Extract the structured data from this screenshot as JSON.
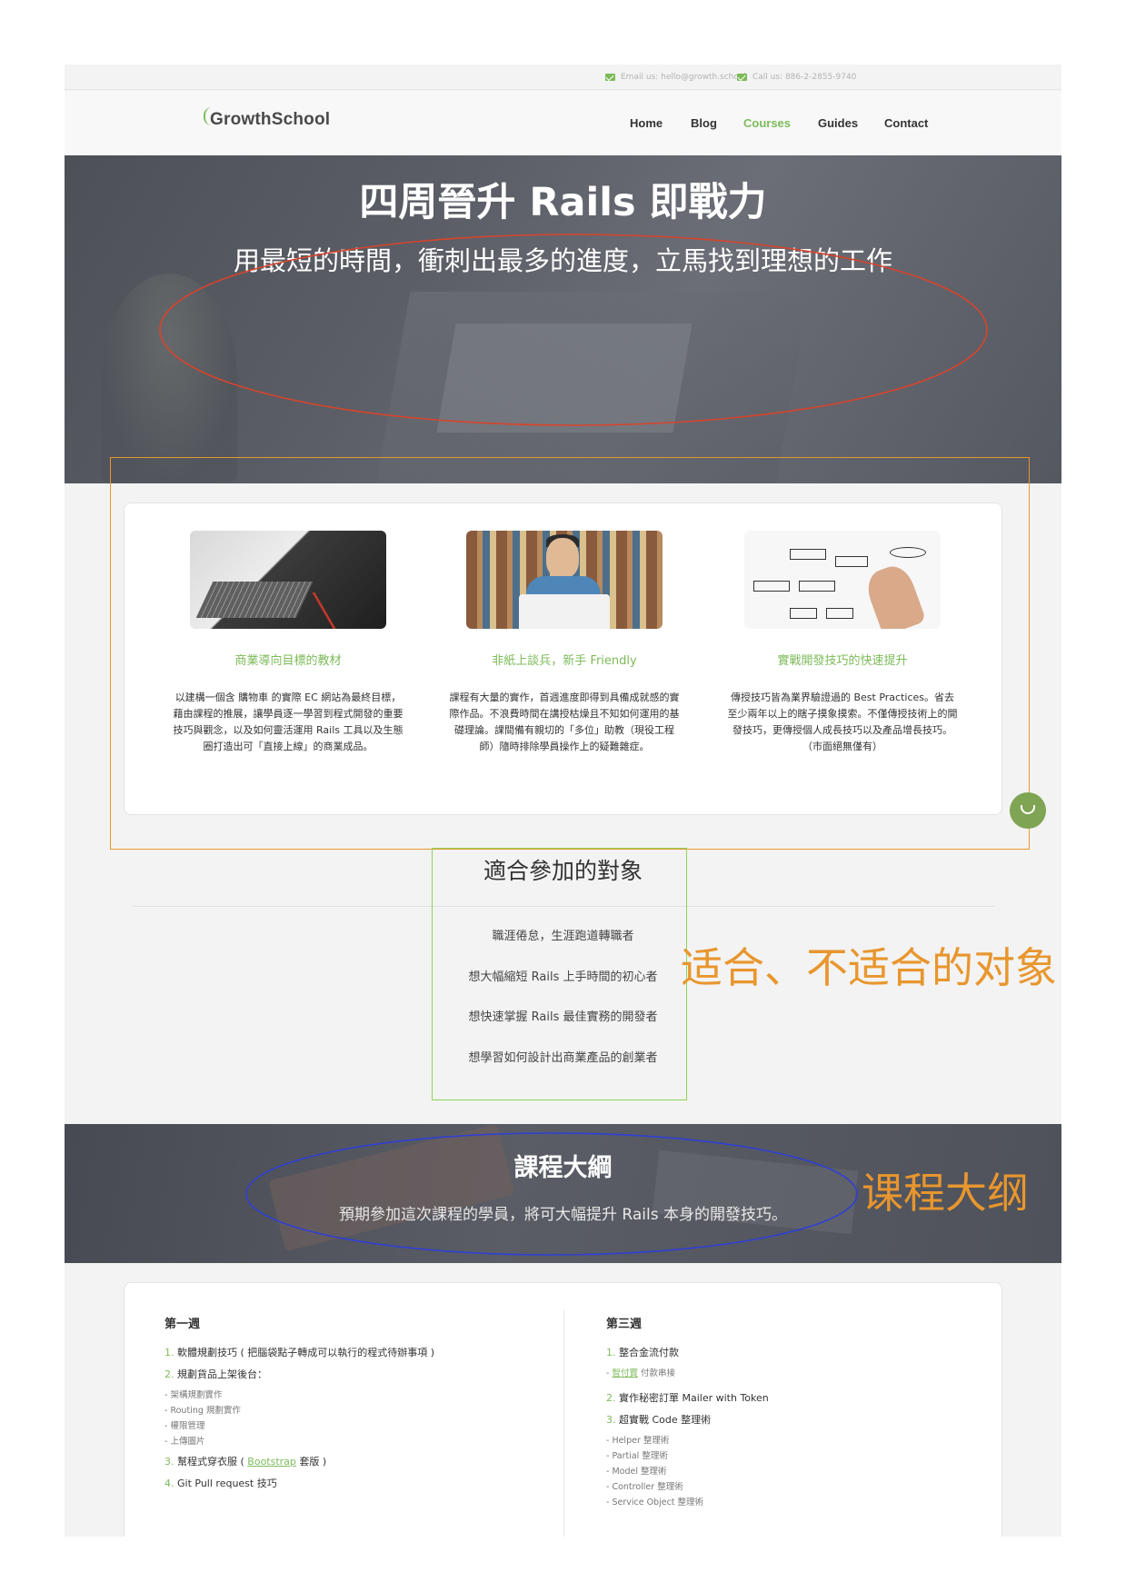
{
  "topbar": {
    "email": "Email us: hello@growth.school",
    "phone": "Call us: 886-2-2855-9740"
  },
  "header": {
    "logo": "GrowthSchool",
    "nav": [
      "Home",
      "Blog",
      "Courses",
      "Guides",
      "Contact"
    ],
    "active_nav": "Courses"
  },
  "hero": {
    "title": "四周晉升 Rails 即戰力",
    "subtitle": "用最短的時間，衝刺出最多的進度，立馬找到理想的工作"
  },
  "features": [
    {
      "title": "商業導向目標的教材",
      "body": "以建構一個含 購物車 的實際 EC 網站為最終目標，藉由課程的推展，讓學員逐一學習到程式開發的重要技巧與觀念，以及如何靈活運用 Rails 工具以及生態圈打造出可「直接上線」的商業成品。"
    },
    {
      "title": "非紙上談兵，新手 Friendly",
      "body": "課程有大量的實作，首週進度即得到具備成就感的實際作品。不浪費時間在講授枯燥且不知如何運用的基礎理論。課間備有親切的「多位」助教（現役工程師）隨時排除學員操作上的疑難雜症。"
    },
    {
      "title": "實戰開發技巧的快速提升",
      "body": "傳授技巧皆為業界驗證過的 Best Practices。省去至少兩年以上的瞎子摸象摸索。不僅傳授技術上的開發技巧，更傳授個人成長技巧以及產品增長技巧。（市面絕無僅有）"
    }
  ],
  "audience": {
    "title": "適合參加的對象",
    "items": [
      "職涯倦怠，生涯跑道轉職者",
      "想大幅縮短 Rails 上手時間的初心者",
      "想快速掌握 Rails 最佳實務的開發者",
      "想學習如何設計出商業產品的創業者"
    ]
  },
  "outline": {
    "title": "課程大綱",
    "subtitle": "預期參加這次課程的學員，將可大幅提升 Rails 本身的開發技巧。"
  },
  "syllabus": {
    "week1": {
      "title": "第一週",
      "items": [
        {
          "num": "1.",
          "text": "軟體規劃技巧 ( 把腦袋點子轉成可以執行的程式待辦事項 )"
        },
        {
          "num": "2.",
          "text": "規劃貨品上架後台："
        }
      ],
      "subs": [
        "- 架構規劃實作",
        "- Routing 規劃實作",
        "- 權限管理",
        "- 上傳圖片"
      ],
      "items2": [
        {
          "num": "3.",
          "pre": "幫程式穿衣服 ( ",
          "link": "Bootstrap",
          "post": " 套版 )"
        },
        {
          "num": "4.",
          "text": "Git Pull request 技巧"
        }
      ]
    },
    "week3": {
      "title": "第三週",
      "items": [
        {
          "num": "1.",
          "text": "整合金流付款"
        }
      ],
      "sub_link": "智付寶",
      "sub_link_post": " 付款串接",
      "items2": [
        {
          "num": "2.",
          "text": "實作秘密訂單 Mailer with Token"
        },
        {
          "num": "3.",
          "text": "超實戰 Code 整理術"
        }
      ],
      "subs": [
        "- Helper 整理術",
        "- Partial 整理術",
        "- Model 整理術",
        "- Controller 整理術",
        "- Service Object 整理術"
      ]
    }
  },
  "annotations": {
    "audience_note": "适合、不适合的对象",
    "outline_note": "课程大纲"
  },
  "colors": {
    "accent_green": "#7dbb5a",
    "annotation_red": "#d9432b",
    "annotation_orange": "#e8962e",
    "annotation_lime": "#8fd45a",
    "annotation_blue": "#2f3fd6"
  }
}
